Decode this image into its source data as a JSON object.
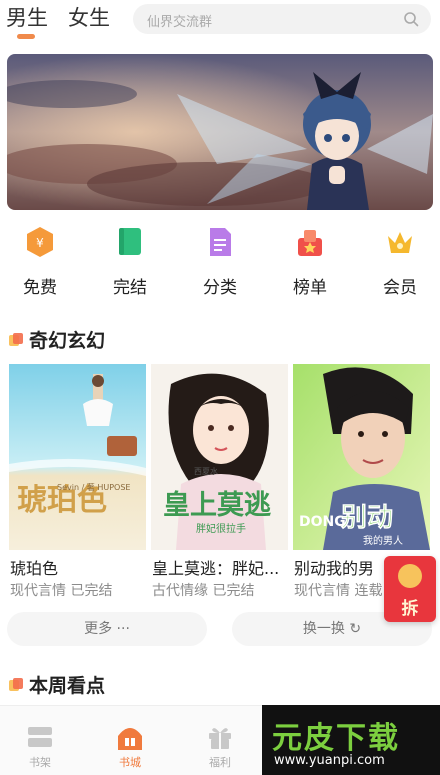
{
  "header": {
    "tabs": [
      {
        "label": "男生",
        "active": true
      },
      {
        "label": "女生",
        "active": false
      }
    ],
    "search": {
      "placeholder": "仙界交流群",
      "icon": "search-icon"
    }
  },
  "banner": {
    "icon": "banner-illustration"
  },
  "quick_nav": [
    {
      "label": "免费",
      "icon": "free-icon",
      "color": "#f59a3a"
    },
    {
      "label": "完结",
      "icon": "book-complete-icon",
      "color": "#2fbf7e"
    },
    {
      "label": "分类",
      "icon": "category-icon",
      "color": "#b97be8"
    },
    {
      "label": "榜单",
      "icon": "ranking-icon",
      "color": "#f0504a"
    },
    {
      "label": "会员",
      "icon": "vip-crown-icon",
      "color": "#f5b82e"
    }
  ],
  "section_fantasy": {
    "title": "奇幻玄幻",
    "books": [
      {
        "title": "琥珀色",
        "meta": "现代言情 已完结",
        "cover_text": "琥珀色",
        "cover_sub": "Sevin / 著 HUPOSE"
      },
      {
        "title": "皇上莫逃：胖妃...",
        "meta": "古代情缘 已完结",
        "cover_text": "皇上莫逃",
        "cover_sub": "胖妃很拉手",
        "cover_author": "西夏水"
      },
      {
        "title": "别动我的男",
        "meta": "现代言情 连载",
        "cover_text": "别动",
        "cover_sub": "我的男人",
        "cover_en": "DONG"
      }
    ],
    "more_label": "更多 ···",
    "swap_label": "换一换 ↻"
  },
  "section_weekly": {
    "title": "本周看点"
  },
  "red_envelope": {
    "label": "拆"
  },
  "tabbar": [
    {
      "label": "书架",
      "icon": "bookshelf-icon",
      "active": false
    },
    {
      "label": "书城",
      "icon": "bookstore-icon",
      "active": true
    },
    {
      "label": "福利",
      "icon": "gift-icon",
      "active": false
    }
  ],
  "watermark": {
    "big": "元皮下载",
    "small": "www.yuanpi.com"
  },
  "colors": {
    "accent": "#f08a4b",
    "red_envelope": "#e8363d"
  }
}
